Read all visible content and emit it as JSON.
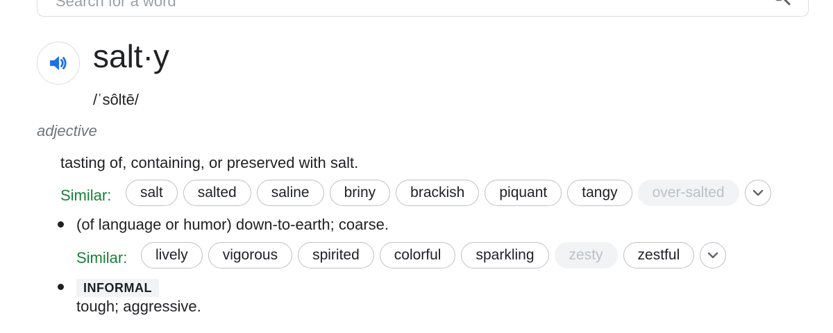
{
  "search": {
    "placeholder": "Search for a word"
  },
  "entry": {
    "word": "salt·y",
    "phonetic": "/ˈsôltē/",
    "part_of_speech": "adjective",
    "audio_icon": "speaker-icon"
  },
  "senses": [
    {
      "definition": "tasting of, containing, or preserved with salt.",
      "similar_label": "Similar:",
      "similar": [
        {
          "word": "salt",
          "disabled": false
        },
        {
          "word": "salted",
          "disabled": false
        },
        {
          "word": "saline",
          "disabled": false
        },
        {
          "word": "briny",
          "disabled": false
        },
        {
          "word": "brackish",
          "disabled": false
        },
        {
          "word": "piquant",
          "disabled": false
        },
        {
          "word": "tangy",
          "disabled": false
        },
        {
          "word": "over-salted",
          "disabled": true
        }
      ]
    },
    {
      "definition": "(of language or humor) down-to-earth; coarse.",
      "similar_label": "Similar:",
      "similar": [
        {
          "word": "lively",
          "disabled": false
        },
        {
          "word": "vigorous",
          "disabled": false
        },
        {
          "word": "spirited",
          "disabled": false
        },
        {
          "word": "colorful",
          "disabled": false
        },
        {
          "word": "sparkling",
          "disabled": false
        },
        {
          "word": "zesty",
          "disabled": true
        },
        {
          "word": "zestful",
          "disabled": false
        }
      ]
    },
    {
      "label": "INFORMAL",
      "definition": "tough; aggressive."
    }
  ],
  "colors": {
    "similar_label": "#188038",
    "audio_icon": "#1a73e8",
    "disabled_chip_bg": "#f1f3f4",
    "disabled_chip_text": "#bdc1c6"
  }
}
